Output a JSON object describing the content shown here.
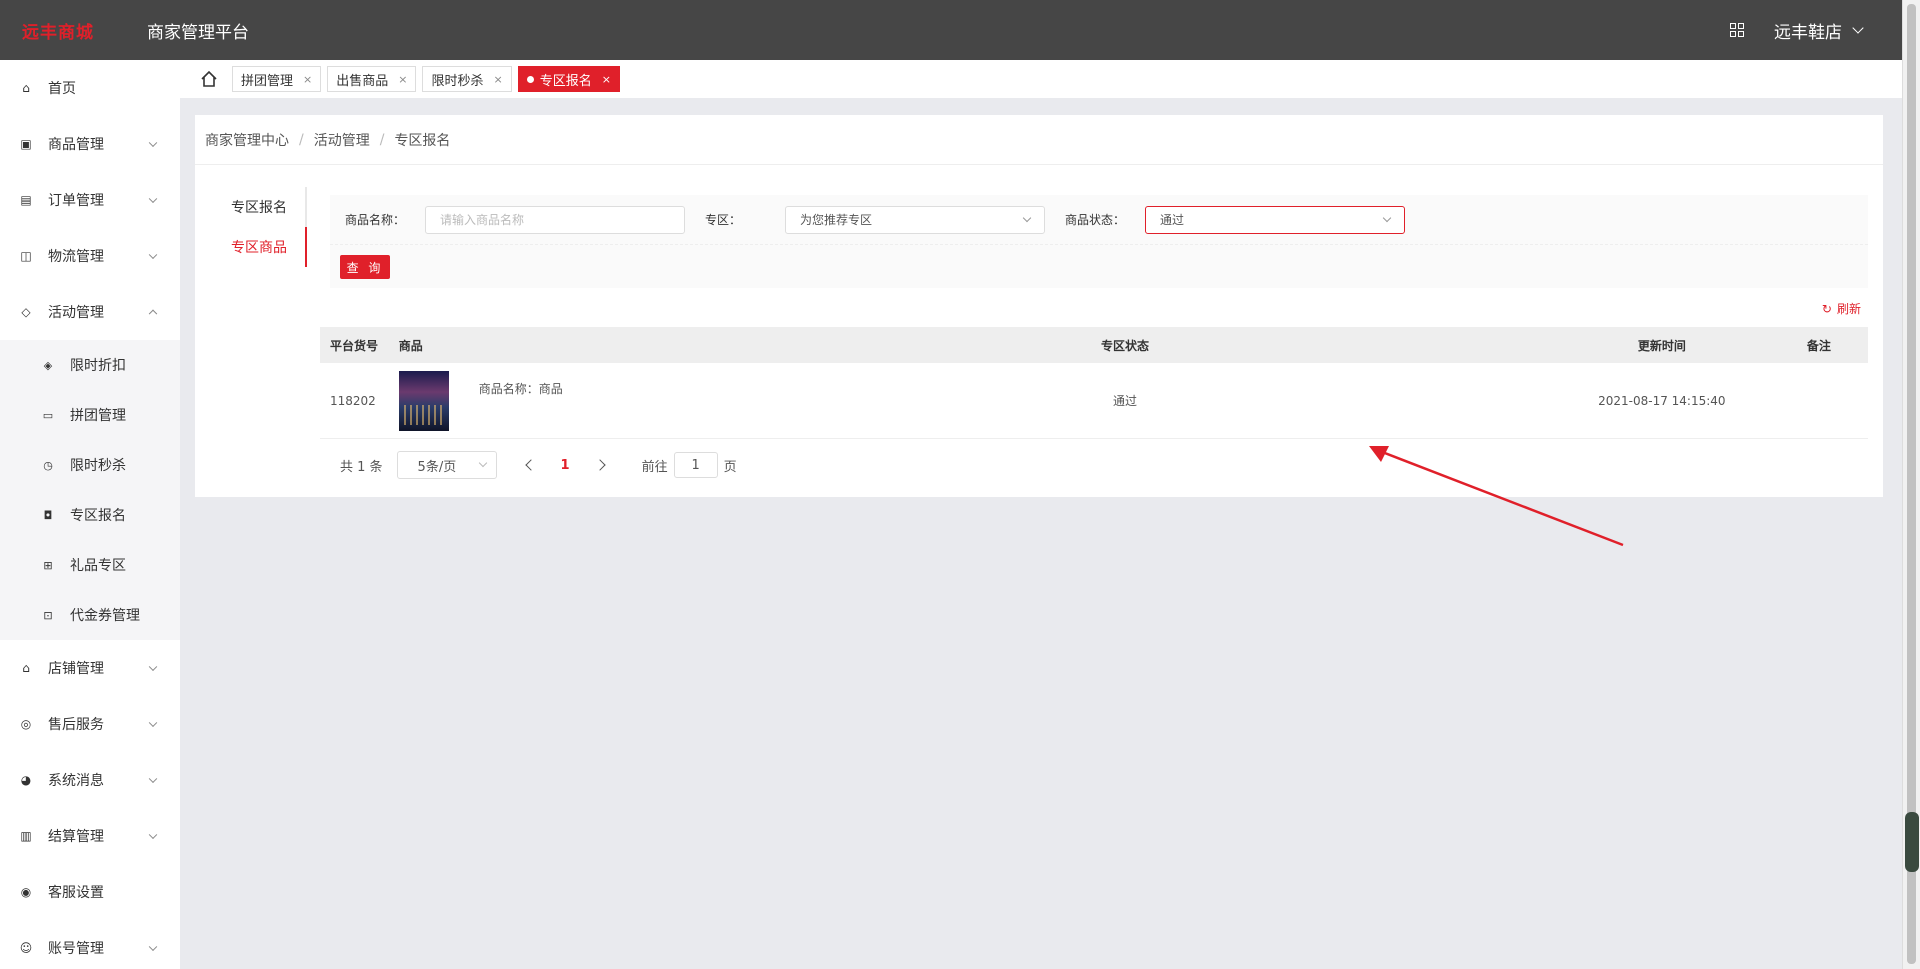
{
  "header": {
    "logo": "远丰商城",
    "platform_title": "商家管理平台",
    "shop_name": "远丰鞋店"
  },
  "sidebar": {
    "items": [
      {
        "label": "首页",
        "icon": "home-icon"
      },
      {
        "label": "商品管理",
        "icon": "box-icon"
      },
      {
        "label": "订单管理",
        "icon": "order-icon"
      },
      {
        "label": "物流管理",
        "icon": "truck-icon"
      },
      {
        "label": "活动管理",
        "icon": "tag-icon"
      },
      {
        "label": "店铺管理",
        "icon": "store-icon"
      },
      {
        "label": "售后服务",
        "icon": "service-icon"
      },
      {
        "label": "系统消息",
        "icon": "message-icon"
      },
      {
        "label": "结算管理",
        "icon": "settlement-icon"
      },
      {
        "label": "客服设置",
        "icon": "support-icon"
      },
      {
        "label": "账号管理",
        "icon": "account-icon"
      }
    ],
    "activity_sub": [
      {
        "label": "限时折扣",
        "icon": "discount-icon"
      },
      {
        "label": "拼团管理",
        "icon": "group-buy-icon"
      },
      {
        "label": "限时秒杀",
        "icon": "clock-icon"
      },
      {
        "label": "专区报名",
        "icon": "zone-icon"
      },
      {
        "label": "礼品专区",
        "icon": "gift-icon"
      },
      {
        "label": "代金券管理",
        "icon": "coupon-icon"
      }
    ]
  },
  "tabs": [
    {
      "label": "拼团管理"
    },
    {
      "label": "出售商品"
    },
    {
      "label": "限时秒杀"
    },
    {
      "label": "专区报名"
    }
  ],
  "breadcrumb": {
    "root": "商家管理中心",
    "parent": "活动管理",
    "current": "专区报名"
  },
  "side_tabs": [
    "专区报名",
    "专区商品"
  ],
  "filters": {
    "name_label": "商品名称：",
    "name_placeholder": "请输入商品名称",
    "zone_label": "专区：",
    "zone_value": "为您推荐专区",
    "status_label": "商品状态：",
    "status_value": "通过",
    "query_button": "查 询"
  },
  "refresh_label": "刷新",
  "table": {
    "headers": [
      "平台货号",
      "商品",
      "专区状态",
      "更新时间",
      "备注"
    ],
    "rows": [
      {
        "sku": "118202",
        "product": "商品名称：商品",
        "status": "通过",
        "updated": "2021-08-17 14:15:40",
        "note": ""
      }
    ]
  },
  "pager": {
    "total": "共 1 条",
    "page_size": "5条/页",
    "current_page": "1",
    "goto_label": "前往",
    "goto_value": "1",
    "page_suffix": "页"
  },
  "colors": {
    "accent": "#e0202a",
    "header_bg": "#464646"
  }
}
